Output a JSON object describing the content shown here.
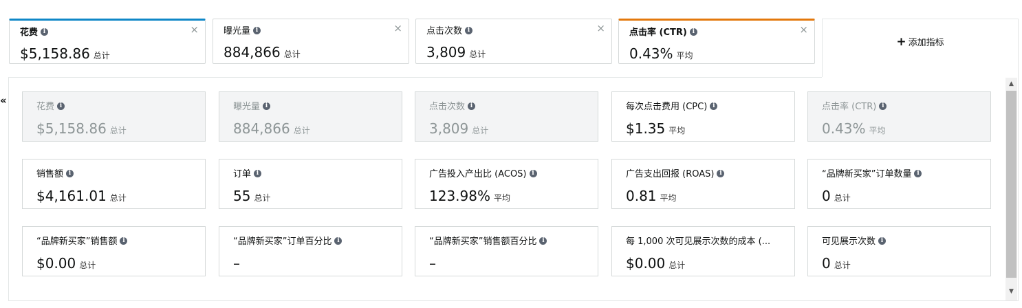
{
  "top_tabs": [
    {
      "label": "花费",
      "value": "$5,158.86",
      "unit": "总计",
      "close": "×"
    },
    {
      "label": "曝光量",
      "value": "884,866",
      "unit": "总计",
      "close": "×"
    },
    {
      "label": "点击次数",
      "value": "3,809",
      "unit": "总计",
      "close": "×"
    },
    {
      "label": "点击率 (CTR)",
      "value": "0.43%",
      "unit": "平均",
      "close": "×"
    }
  ],
  "add_metric": {
    "plus": "+",
    "label": "添加指标"
  },
  "collapse_glyph": "«",
  "info_glyph": "i",
  "metrics": [
    {
      "label": "花费",
      "value": "$5,158.86",
      "unit": "总计"
    },
    {
      "label": "曝光量",
      "value": "884,866",
      "unit": "总计"
    },
    {
      "label": "点击次数",
      "value": "3,809",
      "unit": "总计"
    },
    {
      "label": "每次点击费用 (CPC)",
      "value": "$1.35",
      "unit": "平均"
    },
    {
      "label": "点击率 (CTR)",
      "value": "0.43%",
      "unit": "平均"
    },
    {
      "label": "销售额",
      "value": "$4,161.01",
      "unit": "总计"
    },
    {
      "label": "订单",
      "value": "55",
      "unit": "总计"
    },
    {
      "label": "广告投入产出比 (ACOS)",
      "value": "123.98%",
      "unit": "平均"
    },
    {
      "label": "广告支出回报 (ROAS)",
      "value": "0.81",
      "unit": "平均"
    },
    {
      "label": "“品牌新买家”订单数量",
      "value": "0",
      "unit": "总计"
    },
    {
      "label": "“品牌新买家”销售额",
      "value": "$0.00",
      "unit": "总计"
    },
    {
      "label": "“品牌新买家”订单百分比",
      "value": "–",
      "unit": ""
    },
    {
      "label": "“品牌新买家”销售额百分比",
      "value": "–",
      "unit": ""
    },
    {
      "label": "每 1,000 次可见展示次数的成本 (...",
      "value": "$0.00",
      "unit": "总计"
    },
    {
      "label": "可见展示次数",
      "value": "0",
      "unit": "总计"
    }
  ],
  "scrollbar": {
    "up": "▲",
    "down": "▼"
  }
}
